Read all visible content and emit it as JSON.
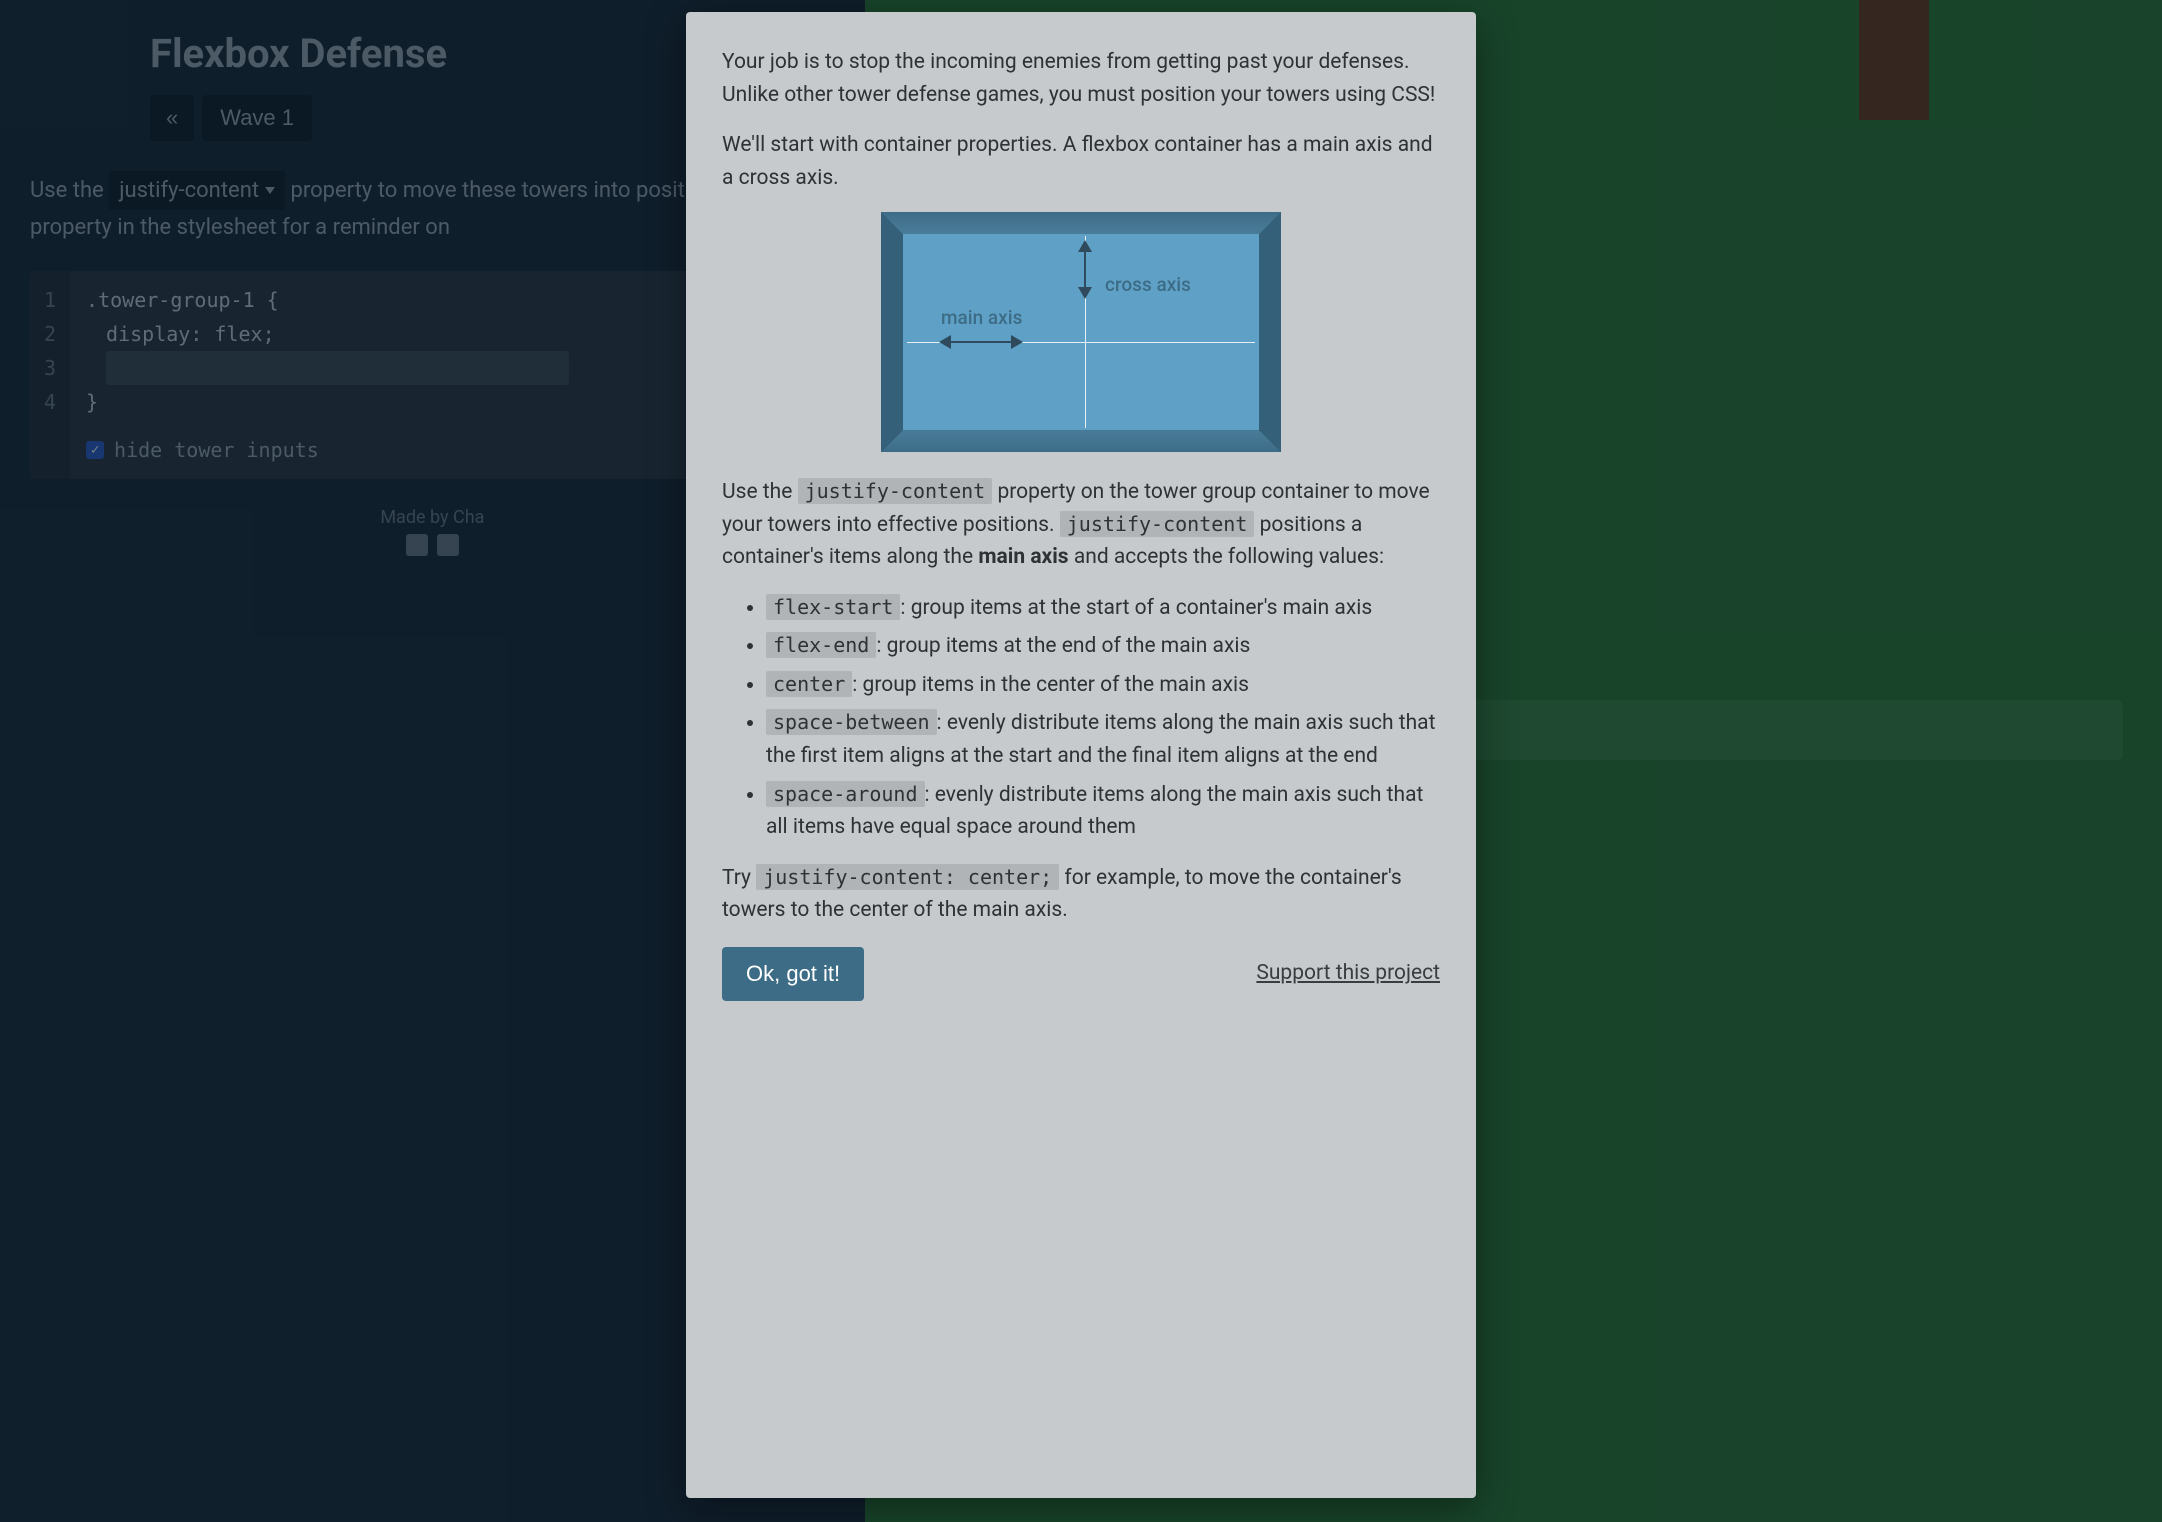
{
  "header": {
    "title": "Flexbox Defense",
    "prev_icon": "«",
    "wave_label": "Wave 1"
  },
  "instructions": {
    "prefix": "Use the ",
    "dropdown_label": "justify-content",
    "rest": "property to move these towers into position. Click the property in the stylesheet for a reminder on"
  },
  "code": {
    "lines": [
      "1",
      "2",
      "3",
      "4"
    ],
    "l1": ".tower-group-1 {",
    "l2": "display: flex;",
    "l3": "",
    "l4": "}"
  },
  "hide_inputs_label": "hide tower inputs",
  "footer_text": "Made by Cha",
  "game_start_label": "",
  "modal": {
    "p1": "Your job is to stop the incoming enemies from getting past your defenses. Unlike other tower defense games, you must position your towers using CSS!",
    "p2": "We'll start with container properties. A flexbox container has a main axis and a cross axis.",
    "diagram": {
      "main_axis": "main axis",
      "cross_axis": "cross axis"
    },
    "p3_a": "Use the ",
    "p3_code1": "justify-content",
    "p3_b": " property on the tower group container to move your towers into effective positions. ",
    "p3_code2": "justify-content",
    "p3_c": " positions a container's items along the ",
    "p3_bold": "main axis",
    "p3_d": " and accepts the following values:",
    "values": [
      {
        "code": "flex-start",
        "desc": ": group items at the start of a container's main axis"
      },
      {
        "code": "flex-end",
        "desc": ": group items at the end of the main axis"
      },
      {
        "code": "center",
        "desc": ": group items in the center of the main axis"
      },
      {
        "code": "space-between",
        "desc": ": evenly distribute items along the main axis such that the first item aligns at the start and the final item aligns at the end"
      },
      {
        "code": "space-around",
        "desc": ": evenly distribute items along the main axis such that all items have equal space around them"
      }
    ],
    "p4_a": "Try ",
    "p4_code": "justify-content: center;",
    "p4_b": " for example, to move the container's towers to the center of the main axis.",
    "ok_label": "Ok, got it!",
    "support_label": "Support this project"
  }
}
